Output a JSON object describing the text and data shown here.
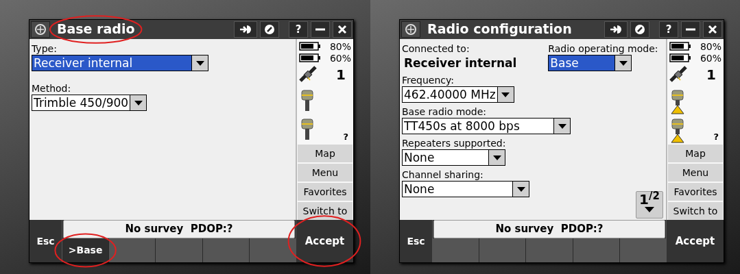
{
  "screens": [
    {
      "title": "Base radio",
      "title_circled": true,
      "help": "?",
      "rows": [
        [
          {
            "label": "Type:",
            "kind": "dropdown",
            "value": "Receiver internal",
            "highlighted": true
          }
        ],
        [
          {
            "label": "Method:",
            "kind": "dropdown",
            "value": "Trimble 450/900",
            "highlighted": false
          }
        ]
      ],
      "status": {
        "batteries": [
          "80%",
          "60%"
        ],
        "satellites": "1",
        "receivers": [
          {
            "kind": "receiver"
          },
          {
            "kind": "receiver",
            "reading": "?"
          }
        ]
      },
      "side_buttons": [
        "Map",
        "Menu",
        "Favorites",
        "Switch to"
      ],
      "status_line": "No survey  PDOP:?",
      "esc": "Esc",
      "accept": {
        "label": "Accept",
        "circled": true
      },
      "softkeys": [
        {
          "label": ">Base",
          "circled": true
        }
      ]
    },
    {
      "title": "Radio configuration",
      "title_circled": false,
      "help": "?",
      "rows": [
        [
          {
            "label": "Connected to:",
            "kind": "text",
            "value": "Receiver internal"
          },
          {
            "label": "Radio operating mode:",
            "kind": "dropdown",
            "value": "Base",
            "highlighted": true
          }
        ],
        [
          {
            "label": "Frequency:",
            "kind": "dropdown",
            "value": "462.40000 MHz",
            "highlighted": false
          }
        ],
        [
          {
            "label": "Base radio mode:",
            "kind": "dropdown",
            "value": "TT450s at 8000 bps",
            "highlighted": false
          }
        ],
        [
          {
            "label": "Repeaters supported:",
            "kind": "dropdown",
            "value": "None",
            "highlighted": false
          }
        ],
        [
          {
            "label": "Channel sharing:",
            "kind": "dropdown",
            "value": "None",
            "highlighted": false
          }
        ]
      ],
      "page": "1$^{/2}$",
      "status": {
        "batteries": [
          "80%",
          "60%"
        ],
        "satellites": "1",
        "receivers": [
          {
            "kind": "receiver-on-tripod"
          },
          {
            "kind": "receiver-on-tripod",
            "reading": "?"
          }
        ]
      },
      "side_buttons": [
        "Map",
        "Menu",
        "Favorites",
        "Switch to"
      ],
      "status_line": "No survey  PDOP:?",
      "esc": "Esc",
      "accept": {
        "label": "Accept",
        "circled": false
      }
    }
  ]
}
